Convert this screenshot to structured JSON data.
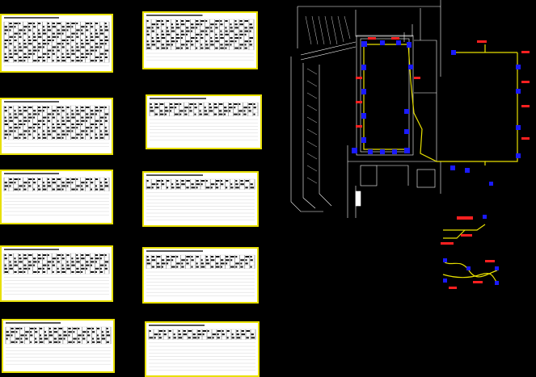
{
  "drawing": {
    "background": "#000000",
    "frame_color": "#e8e000",
    "pipe_color": "#e8e000",
    "node_color": "#1a1aff",
    "label_color": "#ff2020",
    "linework_color": "#ffffff"
  },
  "schedule_sheets": [
    {
      "id": "sheet-1",
      "filled_rows": 12
    },
    {
      "id": "sheet-2",
      "filled_rows": 9
    },
    {
      "id": "sheet-3",
      "filled_rows": 10
    },
    {
      "id": "sheet-4",
      "filled_rows": 4
    },
    {
      "id": "sheet-5",
      "filled_rows": 4
    },
    {
      "id": "sheet-6",
      "filled_rows": 3
    },
    {
      "id": "sheet-7",
      "filled_rows": 6
    },
    {
      "id": "sheet-8",
      "filled_rows": 4
    },
    {
      "id": "sheet-9",
      "filled_rows": 5
    },
    {
      "id": "sheet-10",
      "filled_rows": 3
    }
  ]
}
